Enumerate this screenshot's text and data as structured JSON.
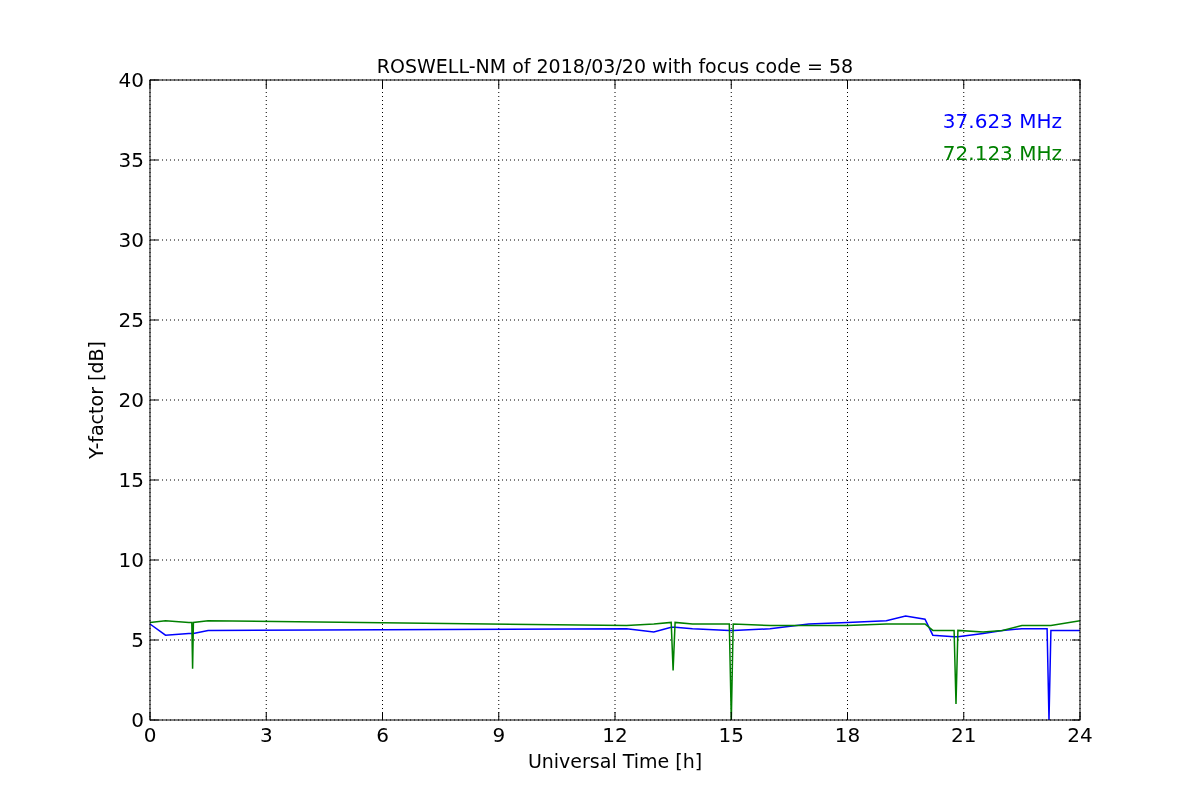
{
  "figure": {
    "chart_data": {
      "type": "line",
      "title": "ROSWELL-NM of 2018/03/20 with focus code = 58",
      "xlabel": "Universal Time [h]",
      "ylabel": "Y-factor [dB]",
      "x": [
        0,
        0.4,
        1.0,
        1.08,
        1.1,
        1.12,
        1.5,
        12.3,
        13.0,
        13.45,
        13.5,
        13.55,
        14,
        14.95,
        15.0,
        15.05,
        16,
        17,
        18,
        19,
        19.5,
        20,
        20.2,
        20.75,
        20.8,
        20.85,
        21.5,
        22,
        22.5,
        23,
        23.15,
        23.2,
        23.25,
        24
      ],
      "series": [
        {
          "name": "37.623 MHz",
          "color": "#0000ff",
          "values": [
            6.0,
            5.3,
            5.4,
            5.4,
            5.4,
            5.4,
            5.6,
            5.7,
            5.5,
            5.8,
            5.8,
            5.8,
            5.7,
            5.6,
            5.6,
            5.6,
            5.7,
            6.0,
            6.1,
            6.2,
            6.5,
            6.3,
            5.3,
            5.2,
            5.2,
            5.2,
            5.4,
            5.6,
            5.7,
            5.7,
            5.7,
            0,
            5.6,
            5.6
          ]
        },
        {
          "name": "72.123 MHz",
          "color": "#008000",
          "values": [
            6.1,
            6.2,
            6.1,
            6.1,
            3.2,
            6.1,
            6.2,
            5.9,
            6.0,
            6.1,
            3.1,
            6.1,
            6.0,
            6.0,
            0,
            6.0,
            5.9,
            5.9,
            5.9,
            6.0,
            6.0,
            6.0,
            5.6,
            5.6,
            1.0,
            5.6,
            5.5,
            5.6,
            5.9,
            5.9,
            5.9,
            5.9,
            5.9,
            6.2
          ]
        }
      ],
      "xlim": [
        0,
        24
      ],
      "ylim": [
        0,
        40
      ],
      "xticks": [
        0,
        3,
        6,
        9,
        12,
        15,
        18,
        21,
        24
      ],
      "yticks": [
        0,
        5,
        10,
        15,
        20,
        25,
        30,
        35,
        40
      ],
      "grid": true
    }
  }
}
